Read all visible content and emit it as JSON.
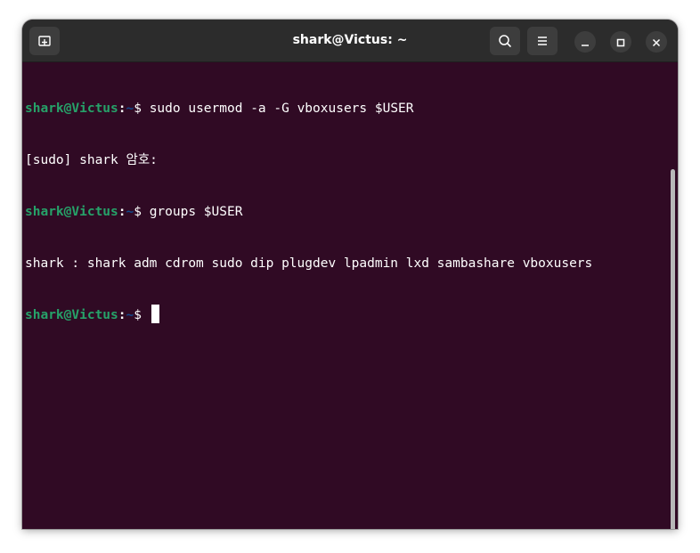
{
  "window": {
    "title": "shark@Victus: ~"
  },
  "titlebar": {
    "new_tab_icon": "new-tab-icon",
    "search_icon": "search-icon",
    "menu_icon": "hamburger-menu-icon",
    "minimize_icon": "minimize-icon",
    "maximize_icon": "maximize-icon",
    "close_icon": "close-icon"
  },
  "terminal": {
    "prompt_user": "shark@Victus",
    "prompt_colon": ":",
    "prompt_path": "~",
    "prompt_symbol": "$ ",
    "lines": [
      {
        "type": "prompt",
        "command": "sudo usermod -a -G vboxusers $USER"
      },
      {
        "type": "output",
        "text": "[sudo] shark 암호:"
      },
      {
        "type": "prompt",
        "command": "groups $USER"
      },
      {
        "type": "output",
        "text": "shark : shark adm cdrom sudo dip plugdev lpadmin lxd sambashare vboxusers"
      },
      {
        "type": "prompt",
        "command": ""
      }
    ]
  },
  "colors": {
    "background": "#300a24",
    "titlebar": "#2c2c2c",
    "prompt_user": "#26a269",
    "prompt_path": "#12488b",
    "text": "#ffffff"
  }
}
